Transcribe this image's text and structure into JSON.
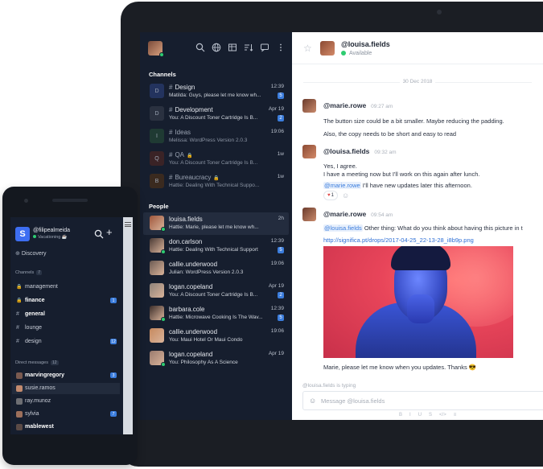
{
  "desktop": {
    "sidebar": {
      "channels_heading": "Channels",
      "people_heading": "People",
      "channels": [
        {
          "badge": "D",
          "name": "Design",
          "preview": "Matilda: Guys, please let me know wh...",
          "time": "12:39",
          "unread": "5",
          "dim": false,
          "badge_color": "#23335e",
          "locked": false
        },
        {
          "badge": "D",
          "name": "Development",
          "preview": "You: A Discount Toner Cartridge Is B...",
          "time": "Apr 19",
          "unread": "2",
          "dim": false,
          "badge_color": "#2a3140",
          "locked": false
        },
        {
          "badge": "I",
          "name": "Ideas",
          "preview": "Melissa: WordPress Version 2.0.3",
          "time": "19:06",
          "unread": "",
          "dim": true,
          "badge_color": "#1f3a33",
          "locked": false
        },
        {
          "badge": "Q",
          "name": "QA",
          "preview": "You: A Discount Toner Cartridge Is B...",
          "time": "1w",
          "unread": "",
          "dim": true,
          "badge_color": "#3a2326",
          "locked": true
        },
        {
          "badge": "B",
          "name": "Bureaucracy",
          "preview": "Hattie: Dealing With Technical Suppo...",
          "time": "1w",
          "unread": "",
          "dim": true,
          "badge_color": "#3a2a1f",
          "locked": true
        }
      ],
      "people": [
        {
          "name": "louisa.fields",
          "preview": "Hattie: Marie, please let me know wh...",
          "time": "2h",
          "unread": "",
          "online": true,
          "color": "#a0573c"
        },
        {
          "name": "don.carlson",
          "preview": "Hattie: Dealing With Technical Support",
          "time": "12:39",
          "unread": "5",
          "online": true,
          "color": "#4a3a35"
        },
        {
          "name": "callie.underwood",
          "preview": "Julian: WordPress Version 2.0.3",
          "time": "19:06",
          "unread": "",
          "online": false,
          "color": "#6b5a52"
        },
        {
          "name": "logan.copeland",
          "preview": "You: A Discount Toner Cartridge Is B...",
          "time": "Apr 19",
          "unread": "2",
          "online": false,
          "color": "#8d8279"
        },
        {
          "name": "barbara.cole",
          "preview": "Hattie: Microwave Cooking Is The Wav...",
          "time": "12:39",
          "unread": "5",
          "online": true,
          "color": "#3c2e2a"
        },
        {
          "name": "callie.underwood",
          "preview": "You: Maui Hotel Or Maui Condo",
          "time": "19:06",
          "unread": "",
          "online": false,
          "color": "#c6895e"
        },
        {
          "name": "logan.copeland",
          "preview": "You: Philosophy As A Science",
          "time": "Apr 19",
          "unread": "",
          "online": true,
          "color": "#9a7b6e"
        }
      ]
    },
    "header": {
      "name": "@louisa.fields",
      "status": "Available"
    },
    "date_divider": "30 Dec 2018",
    "messages": {
      "m1_author": "@marie.rowe",
      "m1_time": "09:27 am",
      "m1_l1": "The button size could be a bit smaller. Maybe reducing the padding.",
      "m1_l2": "Also, the copy needs to be short and easy to read",
      "m2_author": "@louisa.fields",
      "m2_time": "09:32 am",
      "m2_l1": "Yes, I agree.",
      "m2_l2": "I have a meeting now but I'll work on this again after lunch.",
      "m2_mention": "@marie.rowe",
      "m2_l3": " I'll have new updates later this afternoon.",
      "m2_reaction": "1",
      "m3_author": "@marie.rowe",
      "m3_time": "09:54 am",
      "m3_mention": "@louisa.fields",
      "m3_l1": " Other thing: What do you think about having this picture in t",
      "m3_link": "http://significa.pt/drops/2017-04-25_22-13-28_i8b9p.png",
      "m3_l2": "Marie, please let me know when you updates. Thanks 😎"
    },
    "typing": "@louisa.fields is typing",
    "input_placeholder": "Message @louisa.fields",
    "format_bar": [
      "B",
      "I",
      "U",
      "S",
      "</>",
      "≡"
    ]
  },
  "mobile": {
    "username": "@filipealmeida",
    "status": "Vacationing ☕",
    "logo": "S",
    "discovery": "Discovery",
    "channels_heading": "Channels",
    "channels_count": "7",
    "channels": [
      {
        "name": "management",
        "badge": "",
        "locked": true,
        "bold": false,
        "selected": false
      },
      {
        "name": "finance",
        "badge": "1",
        "locked": true,
        "bold": true,
        "selected": false
      },
      {
        "name": "general",
        "badge": "",
        "locked": false,
        "bold": true,
        "selected": false
      },
      {
        "name": "lounge",
        "badge": "",
        "locked": false,
        "bold": false,
        "selected": false
      },
      {
        "name": "design",
        "badge": "12",
        "locked": false,
        "bold": false,
        "selected": false
      }
    ],
    "dm_heading": "Direct messages",
    "dm_count": "12",
    "dms": [
      {
        "name": "marvingregory",
        "badge": "3",
        "bold": true,
        "selected": false,
        "color": "#7a5a50"
      },
      {
        "name": "susie.ramos",
        "badge": "",
        "bold": false,
        "selected": true,
        "color": "#c28a6e"
      },
      {
        "name": "ray.munoz",
        "badge": "",
        "bold": false,
        "selected": false,
        "color": "#6d6e73"
      },
      {
        "name": "sylvia",
        "badge": "7",
        "bold": false,
        "selected": false,
        "color": "#9c6f5b"
      },
      {
        "name": "mablewest",
        "badge": "",
        "bold": true,
        "selected": false,
        "color": "#5a4a46"
      }
    ]
  }
}
